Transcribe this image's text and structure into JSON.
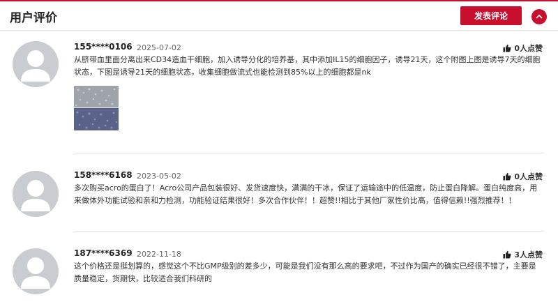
{
  "header": {
    "title": "用户评价",
    "post_button": "发表评论",
    "collapse_icon": "chevron-up-icon",
    "accent_color": "#c8102e"
  },
  "reviews": [
    {
      "user": "155****0106",
      "date": "2025-07-02",
      "likes": "0人点赞",
      "text": "从脐带血里面分离出来CD34造血干细胞，加入诱导分化的培养基，其中添加IL15的细胞因子，诱导21天，这个附图上图是诱导7天的细胞状态，下图是诱导21天的细胞状态，收集细胞做流式也能检测到85%以上的细胞都是nk"
    },
    {
      "user": "158****6168",
      "date": "2023-05-02",
      "likes": "0人点赞",
      "text": "多次购买acro的蛋白了！Acro公司产品包装很好、发货速度快，满满的干冰，保证了运输途中的低温度，防止蛋白降解。蛋白纯度高，用来做体外功能试验和亲和力检测，功能验证结果很好！多次合作伙伴！！超赞!!相比于其他厂家性价比高，值得信赖!!强烈推荐！！"
    },
    {
      "user": "187****6369",
      "date": "2022-11-18",
      "likes": "3人点赞",
      "text": "这个价格还是挺划算的，感觉这个不比GMP级别的差多少，可能是我们没有那么高的要求吧，不过作为国产的确实已经很不错了，主要是质量稳定，货期快，比较适合我们科研的"
    }
  ]
}
